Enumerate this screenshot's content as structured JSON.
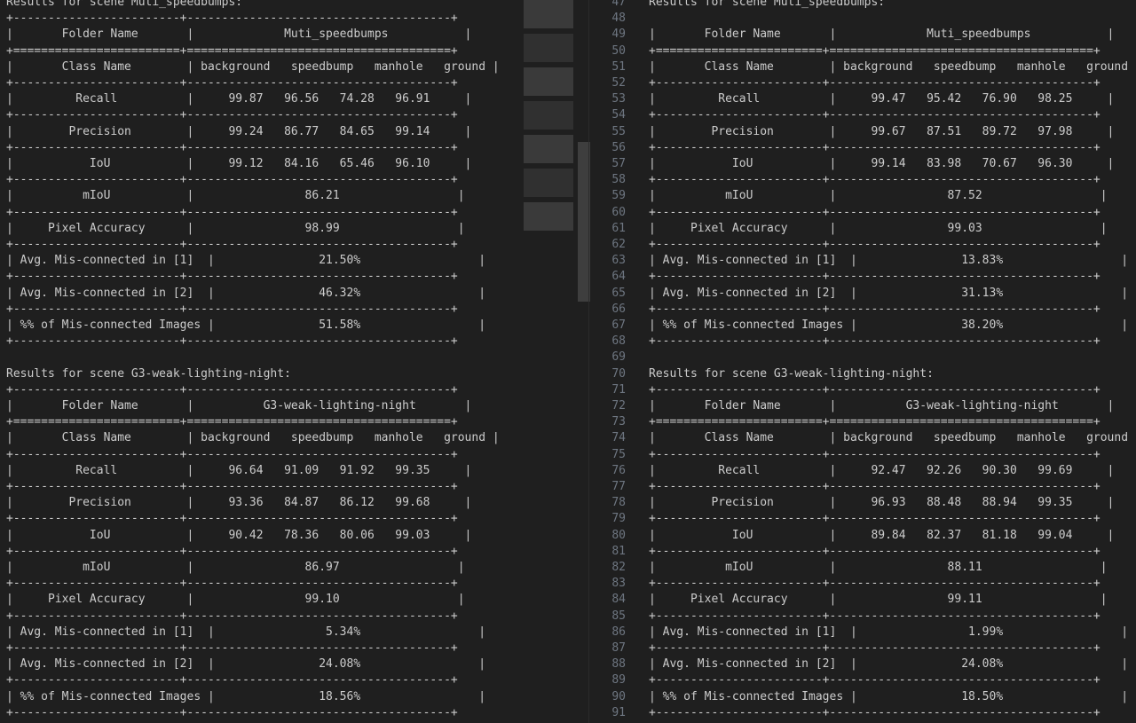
{
  "left": [
    "Results for scene Muti_speedbumps:",
    "+------------------------+--------------------------------------+",
    "|       Folder Name       |             Muti_speedbumps           |",
    "+========================+======================================+",
    "|       Class Name        | background   speedbump   manhole   ground |",
    "+------------------------+--------------------------------------+",
    "|         Recall          |     99.87   96.56   74.28   96.91     |",
    "+------------------------+--------------------------------------+",
    "|        Precision        |     99.24   86.77   84.65   99.14     |",
    "+------------------------+--------------------------------------+",
    "|           IoU           |     99.12   84.16   65.46   96.10     |",
    "+------------------------+--------------------------------------+",
    "|          mIoU           |                86.21                 |",
    "+------------------------+--------------------------------------+",
    "|     Pixel Accuracy      |                98.99                 |",
    "+------------------------+--------------------------------------+",
    "| Avg. Mis-connected in [1]  |               21.50%                 |",
    "+------------------------+--------------------------------------+",
    "| Avg. Mis-connected in [2]  |               46.32%                 |",
    "+------------------------+--------------------------------------+",
    "| %% of Mis-connected Images |               51.58%                 |",
    "+------------------------+--------------------------------------+",
    "",
    "Results for scene G3-weak-lighting-night:",
    "+------------------------+--------------------------------------+",
    "|       Folder Name       |          G3-weak-lighting-night       |",
    "+========================+======================================+",
    "|       Class Name        | background   speedbump   manhole   ground |",
    "+------------------------+--------------------------------------+",
    "|         Recall          |     96.64   91.09   91.92   99.35     |",
    "+------------------------+--------------------------------------+",
    "|        Precision        |     93.36   84.87   86.12   99.68     |",
    "+------------------------+--------------------------------------+",
    "|           IoU           |     90.42   78.36   80.06   99.03     |",
    "+------------------------+--------------------------------------+",
    "|          mIoU           |                86.97                 |",
    "+------------------------+--------------------------------------+",
    "|     Pixel Accuracy      |                99.10                 |",
    "+------------------------+--------------------------------------+",
    "| Avg. Mis-connected in [1]  |                5.34%                 |",
    "+------------------------+--------------------------------------+",
    "| Avg. Mis-connected in [2]  |               24.08%                 |",
    "+------------------------+--------------------------------------+",
    "| %% of Mis-connected Images |               18.56%                 |",
    "+------------------------+--------------------------------------+"
  ],
  "right": {
    "first_line_number": 47,
    "lines": [
      "Results for scene Muti_speedbumps:",
      "",
      "|       Folder Name       |             Muti_speedbumps           |",
      "+========================+======================================+",
      "|       Class Name        | background   speedbump   manhole   ground |",
      "+------------------------+--------------------------------------+",
      "|         Recall          |     99.47   95.42   76.90   98.25     |",
      "+------------------------+--------------------------------------+",
      "|        Precision        |     99.67   87.51   89.72   97.98     |",
      "+------------------------+--------------------------------------+",
      "|           IoU           |     99.14   83.98   70.67   96.30     |",
      "+------------------------+--------------------------------------+",
      "|          mIoU           |                87.52                 |",
      "+------------------------+--------------------------------------+",
      "|     Pixel Accuracy      |                99.03                 |",
      "+------------------------+--------------------------------------+",
      "| Avg. Mis-connected in [1]  |               13.83%                 |",
      "+------------------------+--------------------------------------+",
      "| Avg. Mis-connected in [2]  |               31.13%                 |",
      "+------------------------+--------------------------------------+",
      "| %% of Mis-connected Images |               38.20%                 |",
      "+------------------------+--------------------------------------+",
      "",
      "Results for scene G3-weak-lighting-night:",
      "+------------------------+--------------------------------------+",
      "|       Folder Name       |          G3-weak-lighting-night       |",
      "+========================+======================================+",
      "|       Class Name        | background   speedbump   manhole   ground |",
      "+------------------------+--------------------------------------+",
      "|         Recall          |     92.47   92.26   90.30   99.69     |",
      "+------------------------+--------------------------------------+",
      "|        Precision        |     96.93   88.48   88.94   99.35     |",
      "+------------------------+--------------------------------------+",
      "|           IoU           |     89.84   82.37   81.18   99.04     |",
      "+------------------------+--------------------------------------+",
      "|          mIoU           |                88.11                 |",
      "+------------------------+--------------------------------------+",
      "|     Pixel Accuracy      |                99.11                 |",
      "+------------------------+--------------------------------------+",
      "| Avg. Mis-connected in [1]  |                1.99%                 |",
      "+------------------------+--------------------------------------+",
      "| Avg. Mis-connected in [2]  |               24.08%                 |",
      "+------------------------+--------------------------------------+",
      "| %% of Mis-connected Images |               18.50%                 |",
      "+------------------------+--------------------------------------+"
    ]
  }
}
